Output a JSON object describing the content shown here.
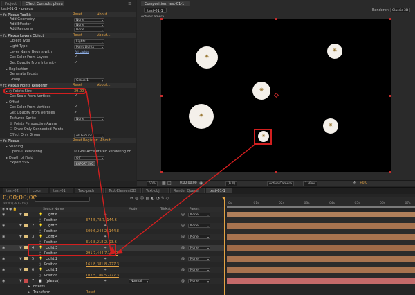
{
  "panels": {
    "project_tab": "Project",
    "effect_controls_tab": "Effect Controls: plexus",
    "composition_tab": "Composition: test-01-1",
    "comp_subtab": "test-01-1",
    "renderer_label": "Renderer:",
    "renderer_value": "Classic 3D",
    "active_camera": "Active Camera",
    "breadcrumb": "test-01-1 • plexus"
  },
  "effect_controls": {
    "toolkit": {
      "title": "Plexus Toolkit",
      "reset": "Reset",
      "about": "About...",
      "rows": [
        {
          "label": "Add Geometry",
          "value": "None"
        },
        {
          "label": "Add Effector",
          "value": "None"
        },
        {
          "label": "Add Renderer",
          "value": "None"
        }
      ]
    },
    "layers_object": {
      "title": "Plexus Layers Object",
      "reset": "Reset",
      "about": "About...",
      "object_type": {
        "label": "Object Type",
        "value": "Lights"
      },
      "light_type": {
        "label": "Light Type",
        "value": "Point Lights"
      },
      "layer_name": {
        "label": "Layer Name Begins with",
        "value": "All Lights"
      },
      "get_color": "Get Color From Layers",
      "get_opacity": "Get Opacity From Intensity",
      "replication": "Replication",
      "generate_facets": "Generate Facets",
      "group": {
        "label": "Group",
        "value": "Group 1"
      }
    },
    "points_renderer": {
      "title": "Plexus Points Renderer",
      "reset": "Reset",
      "about": "About...",
      "points_size": {
        "label": "Points Size",
        "value": "39.00"
      },
      "scale_vertices": "Get Scale From Vertices",
      "offset": "Offset",
      "color_vertices": "Get Color From Vertices",
      "opacity_vertices": "Get Opacity From Vertices",
      "textured_sprite": {
        "label": "Textured Sprite",
        "value": "None"
      },
      "perspective": "Points Perspective Aware",
      "draw_connected": "Draw Only Connected Points",
      "effect_group": {
        "label": "Effect Only Group",
        "value": "All Groups"
      }
    },
    "plexus": {
      "title": "Plexus",
      "reset": "Reset",
      "register": "Register",
      "about": "About...",
      "shading": "Shading",
      "opengl": {
        "label": "OpenGL Rendering",
        "value": "GPU Accelerated Rendering on"
      },
      "dof": {
        "label": "Depth of Field",
        "value": "Off"
      },
      "export_svg": {
        "label": "Export SVG",
        "value": "EXPORT SVG"
      }
    }
  },
  "viewer_bar": {
    "zoom": "50%",
    "timecode": "0;00;00;00",
    "resolution": "(Full)",
    "camera": "Active Camera",
    "views": "1 View",
    "exposure": "+0.0"
  },
  "timeline_tabs": [
    "test-02",
    "color",
    "test-01",
    "Text-path",
    "Text-Element3D",
    "Text-obj",
    "Render Queue",
    "test-01-1"
  ],
  "timeline": {
    "timecode": "0;00;00;00",
    "fps": "00000 (29.97 fps)",
    "search_placeholder": "",
    "col_source": "Source Name",
    "col_mode": "Mode",
    "col_trkmat": "TrkMat",
    "col_parent": "Parent",
    "ruler": [
      "0s",
      "01s",
      "02s",
      "03s",
      "04s",
      "05s",
      "06s",
      "07s"
    ],
    "layers": [
      {
        "num": "1",
        "name": "Light 6",
        "position": "374.5,78.7,-144.6",
        "parent": "None",
        "type": "light"
      },
      {
        "num": "2",
        "name": "Light 5",
        "position": "509.6,244.2,-144.8",
        "parent": "None",
        "type": "light"
      },
      {
        "num": "3",
        "name": "Light 4",
        "position": "316.8,218.2,-93.6",
        "parent": "None",
        "type": "light"
      },
      {
        "num": "4",
        "name": "Light 3",
        "position": "291.7,444.7,163.2",
        "parent": "None",
        "type": "light"
      },
      {
        "num": "5",
        "name": "Light 2",
        "position": "161.8,381.8,-227.3",
        "parent": "None",
        "type": "light"
      },
      {
        "num": "6",
        "name": "Light 1",
        "position": "107.5,186.5,-227.3",
        "parent": "None",
        "type": "light"
      },
      {
        "num": "7",
        "name": "[plexus]",
        "mode": "Normal",
        "parent": "None",
        "type": "solid"
      }
    ],
    "effects_label": "Effects",
    "transform_label": "Transform",
    "transform_reset": "Reset"
  },
  "colors": {
    "accent": "#e3a343",
    "annotation": "#d21f1f",
    "track_light": "#b08a6a",
    "track_solid": "#c46a6a"
  }
}
